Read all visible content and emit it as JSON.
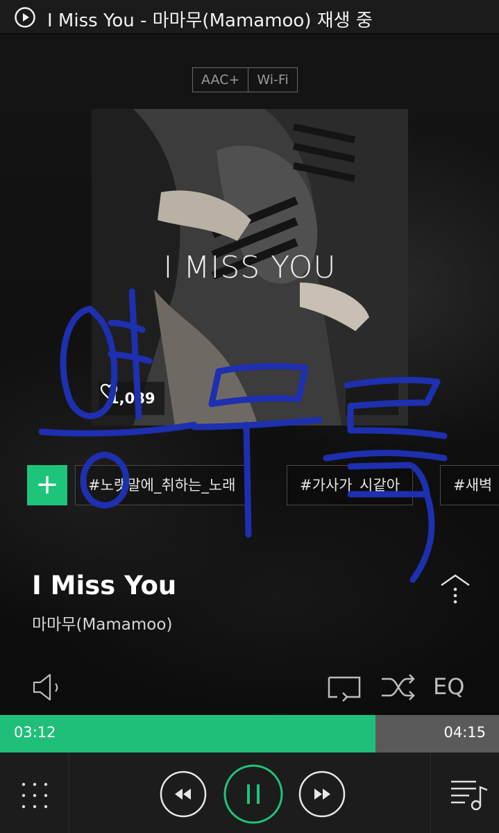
{
  "statusbar": {
    "title": "I Miss You - 마마무(Mamamoo) 재생 중",
    "icon": "play-circle-icon"
  },
  "quality": {
    "codec": "AAC+",
    "network": "Wi-Fi"
  },
  "album": {
    "art_text": "I MISS YOU",
    "likes": "1,089",
    "likes_icon": "heart-icon"
  },
  "tags": {
    "add_label": "+",
    "items": [
      "#노랫말에_취하는_노래",
      "#가사가_시같아",
      "#새벽"
    ]
  },
  "song": {
    "title": "I Miss You",
    "artist": "마마무(Mamamoo)"
  },
  "utilities": {
    "volume_icon": "speaker-icon",
    "repeat_icon": "repeat-icon",
    "shuffle_icon": "shuffle-icon",
    "eq_label": "EQ"
  },
  "progress": {
    "elapsed": "03:12",
    "total": "04:15",
    "fraction": 0.753
  },
  "controls": {
    "menu_icon": "grid-icon",
    "prev_icon": "rewind-icon",
    "play_icon": "pause-icon",
    "next_icon": "fast-forward-icon",
    "playlist_icon": "playlist-icon"
  },
  "colors": {
    "accent": "#1fbf7a",
    "scribble": "#1e2fb0"
  }
}
